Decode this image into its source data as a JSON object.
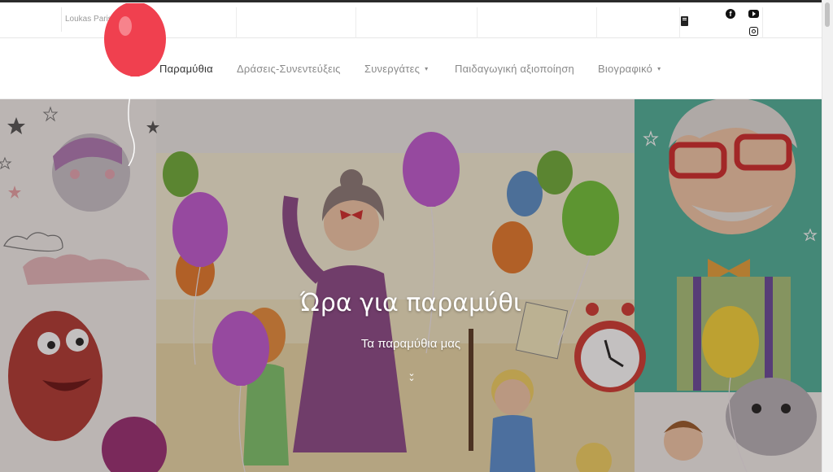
{
  "site": {
    "name": "Loukas Pariso"
  },
  "topbar": {
    "icons": [
      "book-icon",
      "facebook-icon",
      "youtube-icon",
      "instagram-icon"
    ]
  },
  "nav": {
    "items": [
      {
        "label": "Παραμύθια",
        "active": true,
        "has_dropdown": false
      },
      {
        "label": "Δράσεις-Συνεντεύξεις",
        "active": false,
        "has_dropdown": false
      },
      {
        "label": "Συνεργάτες",
        "active": false,
        "has_dropdown": true
      },
      {
        "label": "Παιδαγωγική αξιοποίηση",
        "active": false,
        "has_dropdown": false
      },
      {
        "label": "Βιογραφικό",
        "active": false,
        "has_dropdown": true
      }
    ],
    "dropdown_icon": "▾"
  },
  "hero": {
    "title": "Ώρα για παραμύθι",
    "subtitle": "Τα παραμύθια μας",
    "scroll_icon": "double-chevron-down-icon"
  },
  "colors": {
    "accent_red": "#f0404f",
    "balloon_purple": "#b04fc4",
    "balloon_green": "#6abf3a",
    "balloon_yellow": "#f7d43a",
    "nav_text": "#8a8a8a",
    "nav_active": "#333333"
  }
}
